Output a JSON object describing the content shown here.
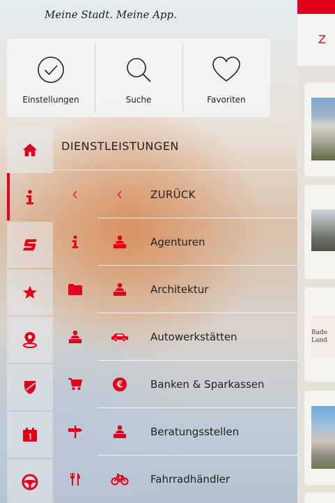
{
  "app": {
    "tagline": "Meine Stadt. Meine App."
  },
  "quick_actions": [
    {
      "label": "Einstellungen",
      "icon": "check-circle-icon"
    },
    {
      "label": "Suche",
      "icon": "search-icon"
    },
    {
      "label": "Favoriten",
      "icon": "heart-icon"
    }
  ],
  "rail": [
    {
      "icon": "home-icon"
    },
    {
      "icon": "info-icon",
      "active": true
    },
    {
      "icon": "sparkasse-s-icon"
    },
    {
      "icon": "star-icon"
    },
    {
      "icon": "map-pin-icon"
    },
    {
      "icon": "shield-icon"
    },
    {
      "icon": "calendar-icon"
    },
    {
      "icon": "steering-wheel-icon"
    }
  ],
  "section": {
    "title": "DIENSTLEISTUNGEN"
  },
  "list": [
    {
      "label": "ZURÜCK",
      "icon_left": "chevron-left-icon",
      "icon_right": "chevron-left-icon"
    },
    {
      "label": "Agenturen",
      "icon_left": "info-icon",
      "icon_right": "person-desk-icon"
    },
    {
      "label": "Architektur",
      "icon_left": "folder-icon",
      "icon_right": "person-desk-icon"
    },
    {
      "label": "Autowerkstätten",
      "icon_left": "person-desk-icon",
      "icon_right": "car-icon"
    },
    {
      "label": "Banken & Sparkassen",
      "icon_left": "shopping-cart-icon",
      "icon_right": "euro-icon"
    },
    {
      "label": "Beratungsstellen",
      "icon_left": "signpost-icon",
      "icon_right": "person-desk-icon"
    },
    {
      "label": "Fahrradhändler",
      "icon_left": "fork-knife-icon",
      "icon_right": "bicycle-icon"
    }
  ],
  "content": {
    "tab_letter": "Z",
    "card_text": "Bade\nLand"
  },
  "colors": {
    "accent": "#e3001b"
  }
}
